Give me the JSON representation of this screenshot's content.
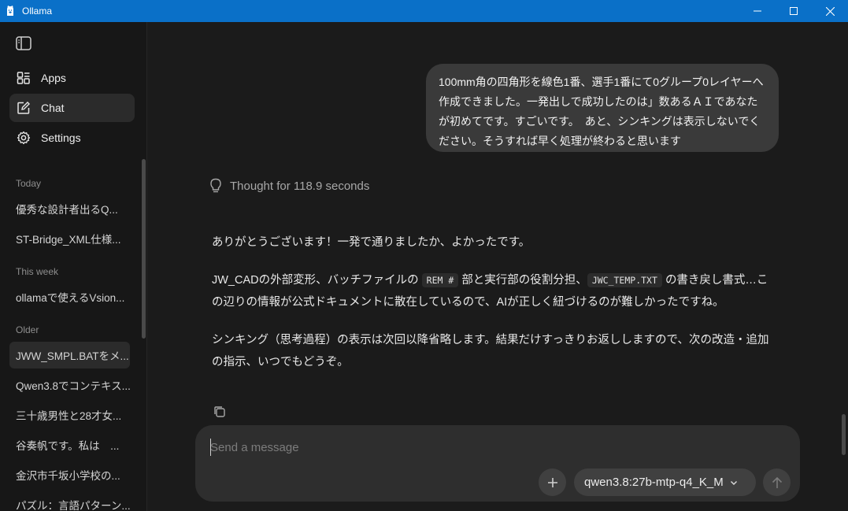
{
  "window": {
    "title": "Ollama"
  },
  "nav": [
    {
      "label": "Apps",
      "icon": "apps-icon"
    },
    {
      "label": "Chat",
      "icon": "chat-edit-icon"
    },
    {
      "label": "Settings",
      "icon": "gear-icon"
    }
  ],
  "sections": {
    "today": "Today",
    "this_week": "This week",
    "older": "Older"
  },
  "chats": {
    "today": [
      "優秀な設計者出るQ...",
      "ST-Bridge_XML仕様..."
    ],
    "this_week": [
      "ollamaで使えるVsion..."
    ],
    "older": [
      "JWW_SMPL.BATをメ...",
      "Qwen3.8でコンテキス...",
      "三十歳男性と28才女...",
      "谷奏帆です。私は　...",
      "金沢市千坂小学校の...",
      "パズル：言語パターン..."
    ]
  },
  "conversation": {
    "user_message": "100mm角の四角形を線色1番、選手1番にて0グループ0レイヤーへ作成できました。一発出しで成功したのは」数あるＡＩであなたが初めてです。すごいです。　あと、シンキングは表示しないでください。そうすれば早く処理が終わると思います",
    "thought": "Thought for 118.9 seconds",
    "reply_p1": "ありがとうございます！一発で通りましたか、よかったです。",
    "reply_p2_a": "JW_CADの外部変形、バッチファイルの",
    "reply_p2_code1": "REM #",
    "reply_p2_b": "部と実行部の役割分担、",
    "reply_p2_code2": "JWC_TEMP.TXT",
    "reply_p2_c": "の書き戻し書式…この辺りの情報が公式ドキュメントに散在しているので、AIが正しく紐づけるのが難しかったですね。",
    "reply_p3": "シンキング（思考過程）の表示は次回以降省略します。結果だけすっきりお返ししますので、次の改造・追加の指示、いつでもどうぞ。"
  },
  "composer": {
    "placeholder": "Send a message",
    "value": "",
    "model": "qwen3.8:27b-mtp-q4_K_M"
  }
}
